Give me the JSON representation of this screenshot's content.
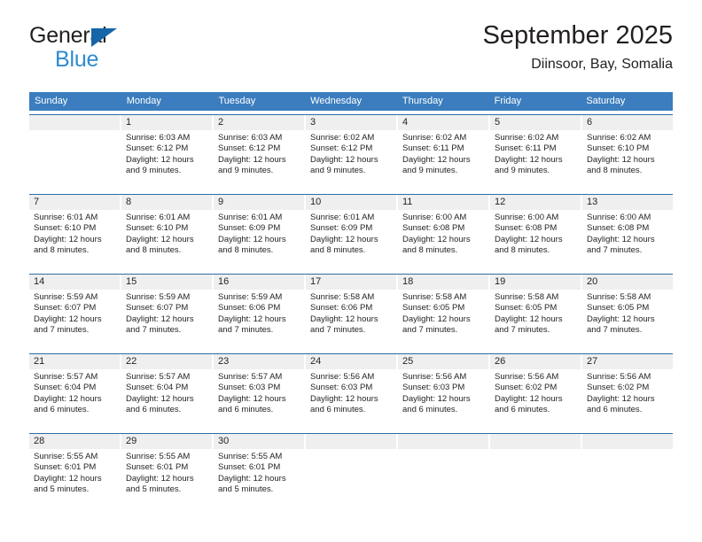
{
  "brand": {
    "name_dark": "General",
    "name_blue": "Blue",
    "triangle_color": "#1565a8",
    "blue_color": "#2e8bd0"
  },
  "header": {
    "title": "September 2025",
    "subtitle": "Diinsoor, Bay, Somalia"
  },
  "theme": {
    "header_bg": "#3b7dbe",
    "week_rule": "#2e6da4",
    "daynum_bg": "#efefef",
    "text": "#231f20"
  },
  "weekdays": [
    "Sunday",
    "Monday",
    "Tuesday",
    "Wednesday",
    "Thursday",
    "Friday",
    "Saturday"
  ],
  "labels": {
    "sunrise_prefix": "Sunrise:",
    "sunset_prefix": "Sunset:",
    "daylight_prefix": "Daylight:"
  },
  "weeks": [
    [
      {
        "day": "",
        "l1": "",
        "l2": "",
        "l3": "",
        "l4": ""
      },
      {
        "day": "1",
        "l1": "Sunrise: 6:03 AM",
        "l2": "Sunset: 6:12 PM",
        "l3": "Daylight: 12 hours",
        "l4": "and 9 minutes."
      },
      {
        "day": "2",
        "l1": "Sunrise: 6:03 AM",
        "l2": "Sunset: 6:12 PM",
        "l3": "Daylight: 12 hours",
        "l4": "and 9 minutes."
      },
      {
        "day": "3",
        "l1": "Sunrise: 6:02 AM",
        "l2": "Sunset: 6:12 PM",
        "l3": "Daylight: 12 hours",
        "l4": "and 9 minutes."
      },
      {
        "day": "4",
        "l1": "Sunrise: 6:02 AM",
        "l2": "Sunset: 6:11 PM",
        "l3": "Daylight: 12 hours",
        "l4": "and 9 minutes."
      },
      {
        "day": "5",
        "l1": "Sunrise: 6:02 AM",
        "l2": "Sunset: 6:11 PM",
        "l3": "Daylight: 12 hours",
        "l4": "and 9 minutes."
      },
      {
        "day": "6",
        "l1": "Sunrise: 6:02 AM",
        "l2": "Sunset: 6:10 PM",
        "l3": "Daylight: 12 hours",
        "l4": "and 8 minutes."
      }
    ],
    [
      {
        "day": "7",
        "l1": "Sunrise: 6:01 AM",
        "l2": "Sunset: 6:10 PM",
        "l3": "Daylight: 12 hours",
        "l4": "and 8 minutes."
      },
      {
        "day": "8",
        "l1": "Sunrise: 6:01 AM",
        "l2": "Sunset: 6:10 PM",
        "l3": "Daylight: 12 hours",
        "l4": "and 8 minutes."
      },
      {
        "day": "9",
        "l1": "Sunrise: 6:01 AM",
        "l2": "Sunset: 6:09 PM",
        "l3": "Daylight: 12 hours",
        "l4": "and 8 minutes."
      },
      {
        "day": "10",
        "l1": "Sunrise: 6:01 AM",
        "l2": "Sunset: 6:09 PM",
        "l3": "Daylight: 12 hours",
        "l4": "and 8 minutes."
      },
      {
        "day": "11",
        "l1": "Sunrise: 6:00 AM",
        "l2": "Sunset: 6:08 PM",
        "l3": "Daylight: 12 hours",
        "l4": "and 8 minutes."
      },
      {
        "day": "12",
        "l1": "Sunrise: 6:00 AM",
        "l2": "Sunset: 6:08 PM",
        "l3": "Daylight: 12 hours",
        "l4": "and 8 minutes."
      },
      {
        "day": "13",
        "l1": "Sunrise: 6:00 AM",
        "l2": "Sunset: 6:08 PM",
        "l3": "Daylight: 12 hours",
        "l4": "and 7 minutes."
      }
    ],
    [
      {
        "day": "14",
        "l1": "Sunrise: 5:59 AM",
        "l2": "Sunset: 6:07 PM",
        "l3": "Daylight: 12 hours",
        "l4": "and 7 minutes."
      },
      {
        "day": "15",
        "l1": "Sunrise: 5:59 AM",
        "l2": "Sunset: 6:07 PM",
        "l3": "Daylight: 12 hours",
        "l4": "and 7 minutes."
      },
      {
        "day": "16",
        "l1": "Sunrise: 5:59 AM",
        "l2": "Sunset: 6:06 PM",
        "l3": "Daylight: 12 hours",
        "l4": "and 7 minutes."
      },
      {
        "day": "17",
        "l1": "Sunrise: 5:58 AM",
        "l2": "Sunset: 6:06 PM",
        "l3": "Daylight: 12 hours",
        "l4": "and 7 minutes."
      },
      {
        "day": "18",
        "l1": "Sunrise: 5:58 AM",
        "l2": "Sunset: 6:05 PM",
        "l3": "Daylight: 12 hours",
        "l4": "and 7 minutes."
      },
      {
        "day": "19",
        "l1": "Sunrise: 5:58 AM",
        "l2": "Sunset: 6:05 PM",
        "l3": "Daylight: 12 hours",
        "l4": "and 7 minutes."
      },
      {
        "day": "20",
        "l1": "Sunrise: 5:58 AM",
        "l2": "Sunset: 6:05 PM",
        "l3": "Daylight: 12 hours",
        "l4": "and 7 minutes."
      }
    ],
    [
      {
        "day": "21",
        "l1": "Sunrise: 5:57 AM",
        "l2": "Sunset: 6:04 PM",
        "l3": "Daylight: 12 hours",
        "l4": "and 6 minutes."
      },
      {
        "day": "22",
        "l1": "Sunrise: 5:57 AM",
        "l2": "Sunset: 6:04 PM",
        "l3": "Daylight: 12 hours",
        "l4": "and 6 minutes."
      },
      {
        "day": "23",
        "l1": "Sunrise: 5:57 AM",
        "l2": "Sunset: 6:03 PM",
        "l3": "Daylight: 12 hours",
        "l4": "and 6 minutes."
      },
      {
        "day": "24",
        "l1": "Sunrise: 5:56 AM",
        "l2": "Sunset: 6:03 PM",
        "l3": "Daylight: 12 hours",
        "l4": "and 6 minutes."
      },
      {
        "day": "25",
        "l1": "Sunrise: 5:56 AM",
        "l2": "Sunset: 6:03 PM",
        "l3": "Daylight: 12 hours",
        "l4": "and 6 minutes."
      },
      {
        "day": "26",
        "l1": "Sunrise: 5:56 AM",
        "l2": "Sunset: 6:02 PM",
        "l3": "Daylight: 12 hours",
        "l4": "and 6 minutes."
      },
      {
        "day": "27",
        "l1": "Sunrise: 5:56 AM",
        "l2": "Sunset: 6:02 PM",
        "l3": "Daylight: 12 hours",
        "l4": "and 6 minutes."
      }
    ],
    [
      {
        "day": "28",
        "l1": "Sunrise: 5:55 AM",
        "l2": "Sunset: 6:01 PM",
        "l3": "Daylight: 12 hours",
        "l4": "and 5 minutes."
      },
      {
        "day": "29",
        "l1": "Sunrise: 5:55 AM",
        "l2": "Sunset: 6:01 PM",
        "l3": "Daylight: 12 hours",
        "l4": "and 5 minutes."
      },
      {
        "day": "30",
        "l1": "Sunrise: 5:55 AM",
        "l2": "Sunset: 6:01 PM",
        "l3": "Daylight: 12 hours",
        "l4": "and 5 minutes."
      },
      {
        "day": "",
        "l1": "",
        "l2": "",
        "l3": "",
        "l4": ""
      },
      {
        "day": "",
        "l1": "",
        "l2": "",
        "l3": "",
        "l4": ""
      },
      {
        "day": "",
        "l1": "",
        "l2": "",
        "l3": "",
        "l4": ""
      },
      {
        "day": "",
        "l1": "",
        "l2": "",
        "l3": "",
        "l4": ""
      }
    ]
  ]
}
